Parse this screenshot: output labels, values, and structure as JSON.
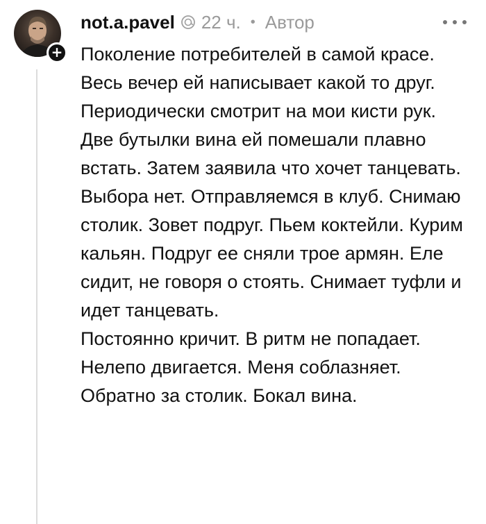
{
  "comment": {
    "author": {
      "username": "not.a.pavel",
      "avatar_icon": "user-photo",
      "badge_icon": "plus-icon",
      "badge_label": "+"
    },
    "time": "22 ч.",
    "separator": "•",
    "author_tag": "Автор",
    "more_icon": "ellipsis-icon",
    "paragraphs": [
      "Поколение потребителей в самой красе.",
      "Весь вечер ей написывает какой то друг.",
      "Периодически смотрит на мои кисти рук.",
      "Две бутылки вина ей помешали плавно встать. Затем заявила что хочет танцевать. Выбора нет. Отправляемся в клуб. Снимаю столик. Зовет подруг. Пьем коктейли. Курим кальян. Подруг ее сняли трое армян. Еле сидит, не говоря о стоять. Снимает туфли и идет танцевать.",
      "Постоянно кричит. В ритм не попадает. Нелепо двигается. Меня соблазняет. Обратно за столик. Бокал вина."
    ]
  }
}
